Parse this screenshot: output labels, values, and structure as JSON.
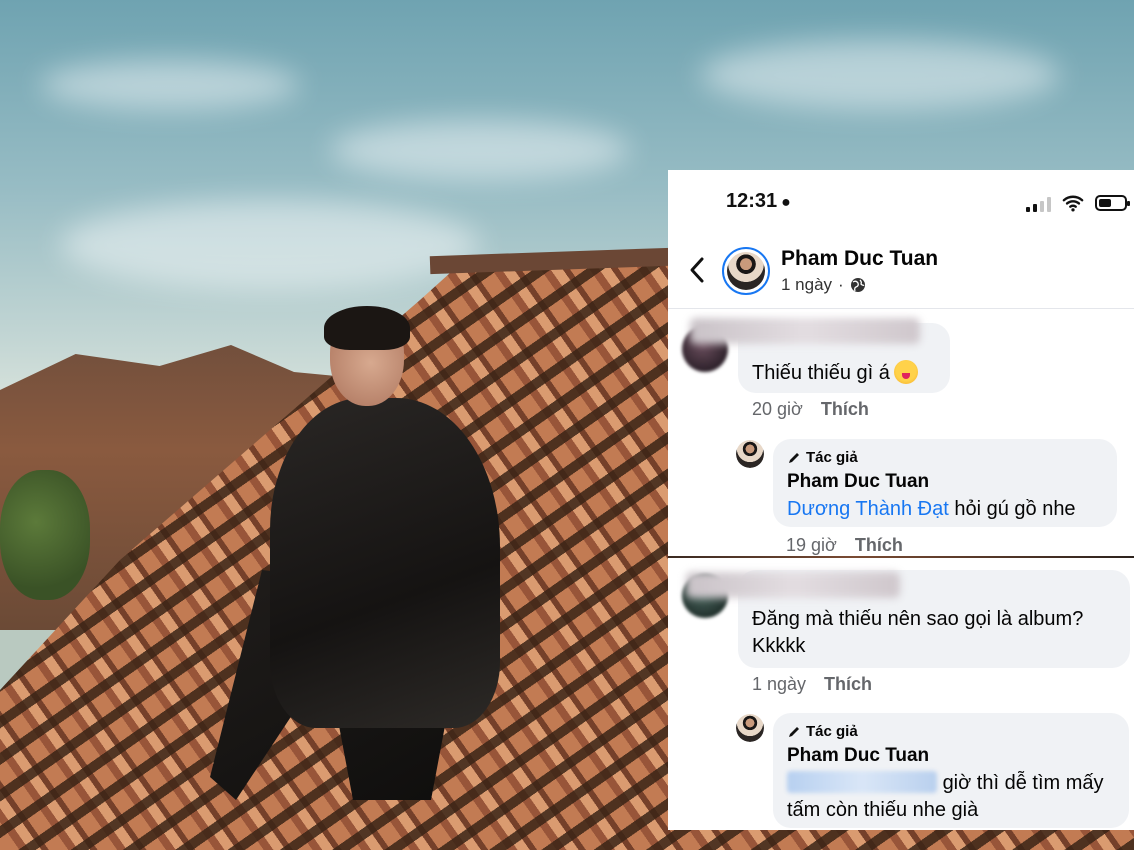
{
  "status_bar": {
    "time": "12:31"
  },
  "post": {
    "author": "Pham Duc Tuan",
    "age": "1 ngày",
    "separator": "·"
  },
  "comments": [
    {
      "text": "Thiếu thiếu gì á",
      "time": "20 giờ",
      "like": "Thích",
      "reply": {
        "badge": "Tác giả",
        "name": "Pham Duc Tuan",
        "mention": "Dương Thành Đạt",
        "text": " hỏi gú gồ nhe",
        "time": "19 giờ",
        "like": "Thích"
      }
    },
    {
      "text_line1": "Đăng mà thiếu nên sao gọi là album?",
      "text_line2": "Kkkkk",
      "time": "1 ngày",
      "like": "Thích",
      "reply": {
        "badge": "Tác giả",
        "name": "Pham Duc Tuan",
        "text_line1": "giờ thì dễ tìm mấy",
        "text_line2": "tấm còn thiếu nhe già"
      }
    }
  ],
  "colors": {
    "accent": "#1877f2",
    "bubble": "#f0f2f5",
    "meta": "#65676b"
  }
}
